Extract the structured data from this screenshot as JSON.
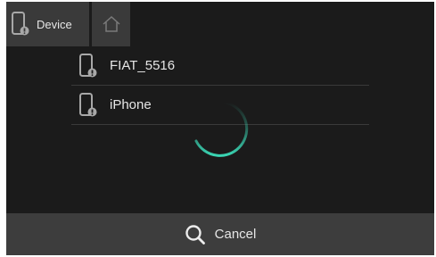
{
  "header": {
    "device_tab_label": "Device",
    "device_tab_icon": "phone-icon",
    "home_tab_icon": "home-icon"
  },
  "devices": [
    {
      "label": "FIAT_5516",
      "icon": "phone-icon"
    },
    {
      "label": "iPhone",
      "icon": "phone-icon"
    }
  ],
  "loading": {
    "icon": "loading-spinner"
  },
  "bottom_bar": {
    "cancel_label": "Cancel",
    "cancel_icon": "search-icon"
  },
  "colors": {
    "background": "#1b1b1b",
    "tab_background": "#3a3a3a",
    "bottom_bar": "#3d3d3d",
    "text": "#e6e6e6",
    "spinner_accent": "#3ad6b4"
  }
}
